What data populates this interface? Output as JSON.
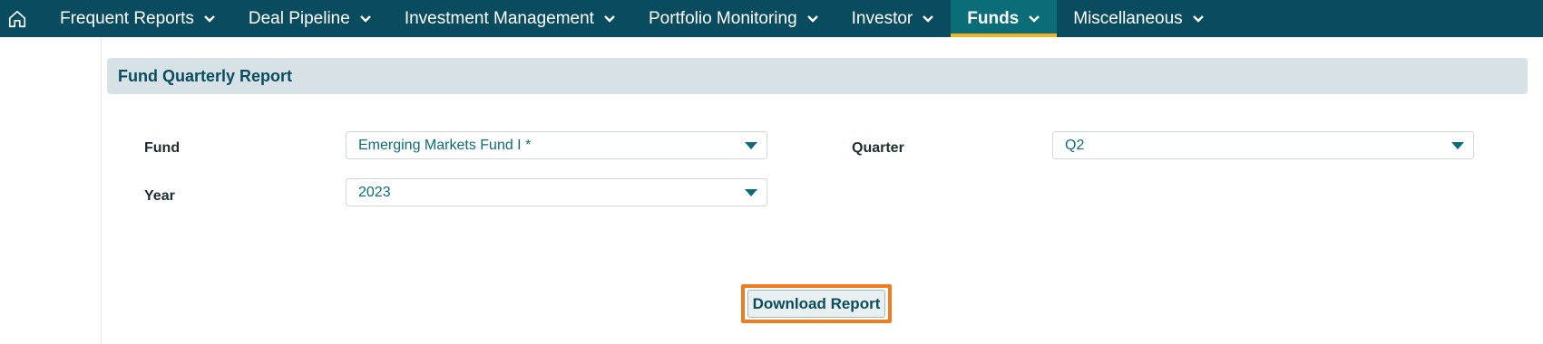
{
  "nav": {
    "home_icon": "home-icon",
    "items": [
      {
        "label": "Frequent Reports",
        "active": false
      },
      {
        "label": "Deal Pipeline",
        "active": false
      },
      {
        "label": "Investment Management",
        "active": false
      },
      {
        "label": "Portfolio Monitoring",
        "active": false
      },
      {
        "label": "Investor",
        "active": false
      },
      {
        "label": "Funds",
        "active": true
      },
      {
        "label": "Miscellaneous",
        "active": false
      }
    ],
    "colors": {
      "bar": "#0a4c5f",
      "active_bg": "#0b6d78",
      "active_underline": "#f0b323"
    }
  },
  "panel": {
    "title": "Fund Quarterly Report"
  },
  "form": {
    "fund_label": "Fund",
    "fund_value": "Emerging Markets Fund I *",
    "quarter_label": "Quarter",
    "quarter_value": "Q2",
    "year_label": "Year",
    "year_value": "2023"
  },
  "actions": {
    "download_label": "Download Report",
    "highlight_color": "#f07c22"
  }
}
